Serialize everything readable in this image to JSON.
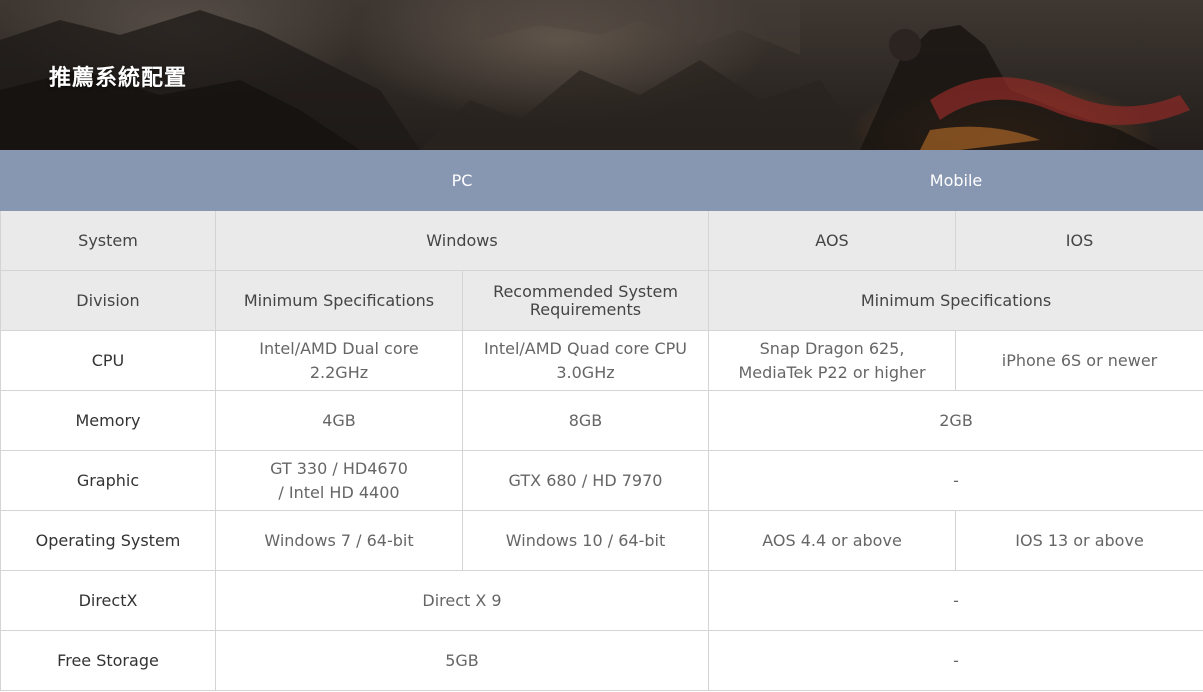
{
  "banner": {
    "title": "推薦系統配置"
  },
  "table": {
    "header": {
      "pc": "PC",
      "mobile": "Mobile"
    },
    "system": {
      "label": "System",
      "pc": "Windows",
      "aos": "AOS",
      "ios": "IOS"
    },
    "division": {
      "label": "Division",
      "pc_min": "Minimum Specifications",
      "pc_rec": "Recommended System Requirements",
      "mobile_min": "Minimum Specifications"
    },
    "cpu": {
      "label": "CPU",
      "pc_min": [
        "Intel/AMD Dual core",
        "2.2GHz"
      ],
      "pc_rec": [
        "Intel/AMD Quad core CPU",
        "3.0GHz"
      ],
      "aos": [
        "Snap Dragon 625,",
        "MediaTek P22 or higher"
      ],
      "ios": "iPhone 6S or newer"
    },
    "memory": {
      "label": "Memory",
      "pc_min": "4GB",
      "pc_rec": "8GB",
      "mobile": "2GB"
    },
    "graphic": {
      "label": "Graphic",
      "pc_min": [
        "GT 330 / HD4670",
        "/ Intel HD 4400"
      ],
      "pc_rec": "GTX 680 / HD 7970",
      "mobile": "-"
    },
    "os": {
      "label": "Operating System",
      "pc_min": "Windows 7 / 64-bit",
      "pc_rec": "Windows 10 / 64-bit",
      "aos": "AOS 4.4 or above",
      "ios": "IOS 13 or above"
    },
    "directx": {
      "label": "DirectX",
      "pc": "Direct X 9",
      "mobile": "-"
    },
    "storage": {
      "label": "Free Storage",
      "pc": "5GB",
      "mobile": "-"
    }
  }
}
